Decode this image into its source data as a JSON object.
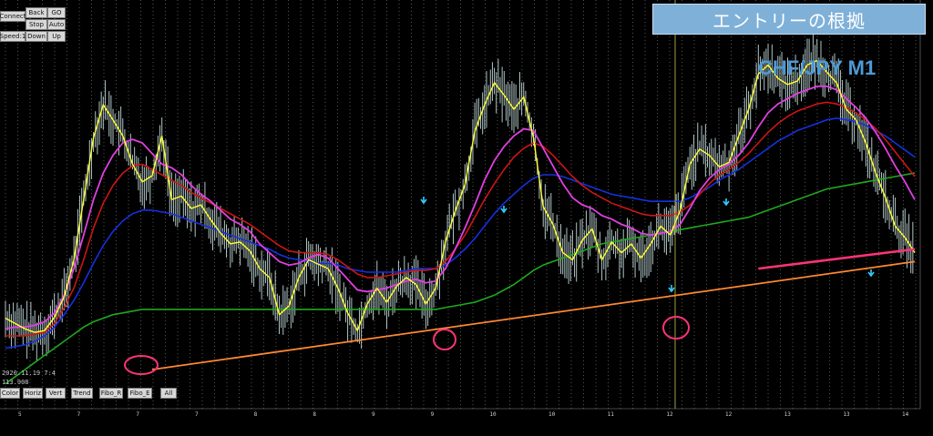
{
  "title_banner": "エントリーの根拠",
  "pair_label": "CHF/JPY M1",
  "top_buttons": [
    {
      "label": "Connect"
    },
    {
      "label": "Back"
    },
    {
      "label": "GO"
    },
    {
      "label": "Stop"
    },
    {
      "label": "Auto"
    },
    {
      "label": "Speed:1"
    },
    {
      "label": "Down"
    },
    {
      "label": "Up"
    }
  ],
  "bottom_buttons": [
    {
      "label": "Color"
    },
    {
      "label": "Horiz"
    },
    {
      "label": "Vert"
    },
    {
      "label": "Trend"
    },
    {
      "label": "Fibo_R"
    },
    {
      "label": "Fibo_E"
    },
    {
      "label": "All"
    }
  ],
  "info_time": "2020.11.19 7:4",
  "info_value": "113.908",
  "colors": {
    "background": "#000000",
    "grid": "#ffffff",
    "candle": "#cfe8e8",
    "price_line": "#ffff33",
    "ma_magenta": "#e040e0",
    "ma_red": "#cc1515",
    "ma_blue": "#1530e0",
    "ma_green": "#1fa81f",
    "trend_orange": "#ff8833",
    "trend_pink": "#ff3377",
    "signal_arrow": "#33ccff",
    "vline": "#c8c850"
  },
  "chart_data": {
    "type": "line",
    "x_ticks": [
      "5",
      "7",
      "7",
      "7",
      "8",
      "8",
      "9",
      "9",
      "10",
      "10",
      "11",
      "12",
      "12",
      "13",
      "13",
      "14"
    ],
    "series": [
      {
        "values": [
          94,
          88,
          82,
          78,
          80,
          95,
          118,
          160,
          228,
          298,
          335,
          318,
          300,
          268,
          248,
          255,
          300,
          228,
          232,
          218,
          222,
          205,
          190,
          178,
          180,
          170,
          150,
          140,
          98,
          108,
          140,
          160,
          155,
          150,
          128,
          100,
          80,
          110,
          128,
          112,
          130,
          140,
          132,
          110,
          128,
          180,
          215,
          245,
          305,
          335,
          360,
          346,
          330,
          344,
          298,
          220,
          200,
          168,
          160,
          182,
          195,
          160,
          180,
          168,
          178,
          162,
          178,
          198,
          188,
          216,
          268,
          285,
          278,
          265,
          270,
          300,
          330,
          370,
          380,
          365,
          358,
          362,
          380,
          385,
          372,
          360,
          330,
          318,
          292,
          258,
          230,
          198,
          185,
          168
        ]
      },
      {
        "values": [
          82,
          84,
          84,
          86,
          90,
          100,
          120,
          150,
          188,
          228,
          258,
          278,
          292,
          296,
          292,
          280,
          268,
          264,
          256,
          244,
          234,
          226,
          216,
          206,
          200,
          192,
          178,
          168,
          158,
          154,
          156,
          162,
          166,
          162,
          150,
          138,
          126,
          124,
          126,
          128,
          132,
          136,
          138,
          134,
          136,
          150,
          172,
          196,
          222,
          250,
          272,
          288,
          300,
          308,
          306,
          286,
          266,
          246,
          230,
          222,
          218,
          210,
          206,
          200,
          196,
          190,
          188,
          190,
          192,
          200,
          218,
          238,
          252,
          262,
          268,
          278,
          292,
          310,
          326,
          336,
          342,
          348,
          352,
          356,
          356,
          352,
          342,
          332,
          320,
          304,
          286,
          266,
          248,
          228
        ]
      },
      {
        "values": [
          74,
          74,
          74,
          76,
          78,
          88,
          106,
          128,
          160,
          196,
          224,
          244,
          258,
          266,
          268,
          262,
          256,
          250,
          244,
          236,
          230,
          224,
          218,
          212,
          206,
          200,
          192,
          184,
          176,
          170,
          168,
          168,
          168,
          166,
          160,
          152,
          144,
          140,
          140,
          142,
          144,
          146,
          148,
          148,
          150,
          158,
          172,
          188,
          208,
          228,
          246,
          262,
          276,
          286,
          292,
          288,
          278,
          266,
          254,
          244,
          236,
          230,
          224,
          220,
          216,
          212,
          210,
          210,
          210,
          214,
          222,
          234,
          246,
          256,
          262,
          270,
          280,
          292,
          304,
          314,
          322,
          328,
          332,
          336,
          338,
          336,
          332,
          326,
          318,
          308,
          296,
          282,
          268,
          254
        ]
      },
      {
        "values": [
          60,
          62,
          64,
          68,
          74,
          84,
          98,
          114,
          134,
          156,
          176,
          192,
          204,
          212,
          216,
          216,
          214,
          212,
          208,
          204,
          200,
          196,
          192,
          188,
          184,
          180,
          176,
          172,
          166,
          162,
          160,
          158,
          156,
          156,
          154,
          150,
          148,
          146,
          146,
          146,
          146,
          148,
          150,
          150,
          150,
          154,
          162,
          172,
          184,
          198,
          212,
          224,
          234,
          244,
          252,
          256,
          256,
          254,
          250,
          246,
          242,
          238,
          234,
          232,
          230,
          228,
          226,
          226,
          226,
          226,
          230,
          236,
          242,
          250,
          256,
          262,
          270,
          278,
          286,
          294,
          300,
          306,
          310,
          314,
          318,
          320,
          318,
          316,
          312,
          306,
          300,
          292,
          284,
          276
        ]
      },
      {
        "values": [
          20,
          28,
          36,
          44,
          52,
          60,
          68,
          76,
          84,
          90,
          94,
          98,
          100,
          102,
          104,
          104,
          104,
          104,
          104,
          104,
          104,
          104,
          104,
          104,
          104,
          104,
          104,
          104,
          104,
          104,
          104,
          104,
          104,
          104,
          104,
          104,
          104,
          104,
          104,
          104,
          104,
          104,
          104,
          104,
          104,
          106,
          108,
          110,
          112,
          116,
          120,
          126,
          132,
          140,
          148,
          154,
          158,
          162,
          166,
          170,
          174,
          178,
          180,
          182,
          184,
          186,
          188,
          190,
          192,
          194,
          196,
          198,
          200,
          202,
          204,
          206,
          208,
          212,
          216,
          220,
          224,
          228,
          232,
          236,
          240,
          242,
          244,
          246,
          248,
          250,
          252,
          254,
          256,
          258
        ]
      }
    ],
    "trend_lines": [
      {
        "color": "orange",
        "from_index": 15,
        "to_index": 93
      },
      {
        "color": "pink",
        "from_index": 77,
        "to_index": 93
      }
    ]
  }
}
